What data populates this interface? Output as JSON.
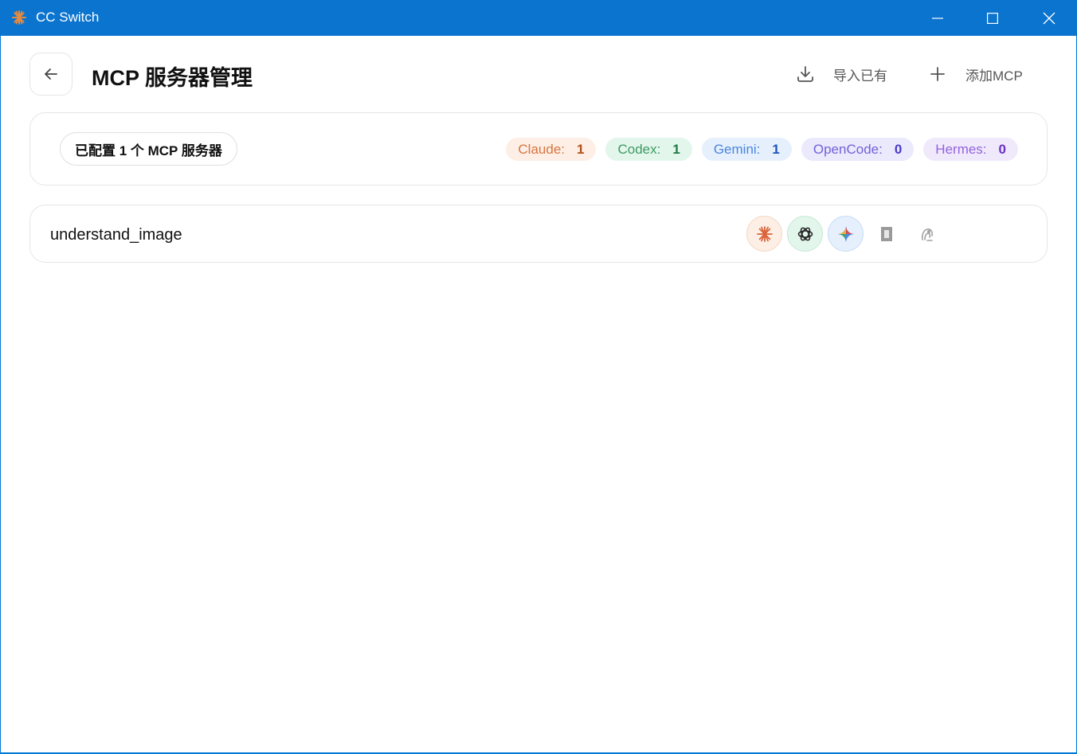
{
  "window": {
    "title": "CC Switch"
  },
  "header": {
    "title": "MCP 服务器管理",
    "import_label": "导入已有",
    "add_label": "添加MCP"
  },
  "summary": {
    "configured_text": "已配置 1 个 MCP 服务器",
    "counts": [
      {
        "name": "Claude:",
        "value": "1"
      },
      {
        "name": "Codex:",
        "value": "1"
      },
      {
        "name": "Gemini:",
        "value": "1"
      },
      {
        "name": "OpenCode:",
        "value": "0"
      },
      {
        "name": "Hermes:",
        "value": "0"
      }
    ]
  },
  "servers": [
    {
      "name": "understand_image",
      "tools": [
        {
          "icon": "claude-icon",
          "enabled": true
        },
        {
          "icon": "openai-icon",
          "enabled": true
        },
        {
          "icon": "gemini-icon",
          "enabled": true
        },
        {
          "icon": "opencode-icon",
          "enabled": false
        },
        {
          "icon": "hermes-icon",
          "enabled": false
        }
      ]
    }
  ],
  "colors": {
    "titlebar": "#0b74cf",
    "claude": "#d9743d",
    "codex": "#3e9a63",
    "gemini": "#4a86db",
    "opencode": "#6f63d9",
    "hermes": "#9362dd"
  }
}
